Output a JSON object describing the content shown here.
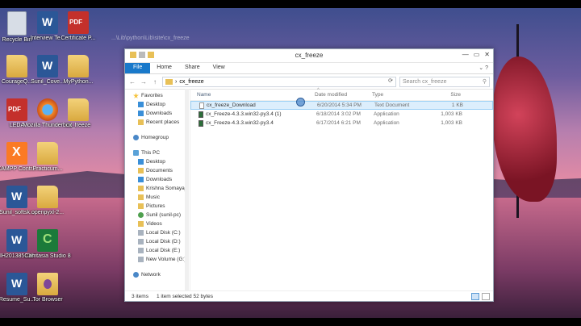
{
  "desktop": {
    "icons": [
      {
        "id": "recycle",
        "label": "Recycle Bin",
        "kind": "bin"
      },
      {
        "id": "interview",
        "label": "Interview Te...",
        "kind": "word"
      },
      {
        "id": "certificate",
        "label": "Certificate P...",
        "kind": "pdf"
      },
      {
        "id": "courage",
        "label": "CourageQ...",
        "kind": "folder"
      },
      {
        "id": "sunil-cover",
        "label": "Sunil_Cove...",
        "kind": "word"
      },
      {
        "id": "mypython",
        "label": "MyPython...",
        "kind": "folder"
      },
      {
        "id": "leda",
        "label": "LEDA",
        "kind": "pdf"
      },
      {
        "id": "firefox",
        "label": "Mozilla Thunderbird",
        "kind": "firefox"
      },
      {
        "id": "cxfreeze-desk",
        "label": "cx_freeze",
        "kind": "folder"
      },
      {
        "id": "xampp",
        "label": "XAMPP Contr...",
        "kind": "xampp"
      },
      {
        "id": "practicum",
        "label": "Practicum...",
        "kind": "folder"
      },
      {
        "id": "sunil-soft",
        "label": "Sunil_softsk...",
        "kind": "word"
      },
      {
        "id": "openpyxl",
        "label": "openpyxl-2...",
        "kind": "folder"
      },
      {
        "id": "ih",
        "label": "IH201385038",
        "kind": "word"
      },
      {
        "id": "camtasia",
        "label": "Camtasia Studio 8",
        "kind": "camtasia"
      },
      {
        "id": "resume",
        "label": "Resume_Su...",
        "kind": "word"
      },
      {
        "id": "tor",
        "label": "Tor Browser",
        "kind": "tor"
      }
    ]
  },
  "ghost_path": "...\\Lib\\python\\Lib\\site\\cx_freeze",
  "window": {
    "title": "cx_freeze",
    "controls": [
      "—",
      "▭",
      "✕"
    ],
    "ribbon": {
      "file": "File",
      "tabs": [
        "Home",
        "Share",
        "View"
      ],
      "expand": "⌄ ?"
    },
    "nav_buttons": [
      "←",
      "→",
      "↑"
    ],
    "address": "cx_freeze",
    "search_placeholder": "Search cx_freeze",
    "sidebar": {
      "favorites": "Favorites",
      "fav_items": [
        "Desktop",
        "Downloads",
        "Recent places"
      ],
      "homegroup": "Homegroup",
      "thispc": "This PC",
      "pc_items": [
        {
          "label": "Desktop",
          "icon": "blue"
        },
        {
          "label": "Documents",
          "icon": "yellow"
        },
        {
          "label": "Downloads",
          "icon": "blue"
        },
        {
          "label": "Krishna Somayaji",
          "icon": "yellow"
        },
        {
          "label": "Music",
          "icon": "yellow"
        },
        {
          "label": "Pictures",
          "icon": "yellow"
        },
        {
          "label": "Sunil (sunil-pc)",
          "icon": "green"
        },
        {
          "label": "Videos",
          "icon": "yellow"
        },
        {
          "label": "Local Disk (C:)",
          "icon": "disk"
        },
        {
          "label": "Local Disk (D:)",
          "icon": "disk"
        },
        {
          "label": "Local Disk (E:)",
          "icon": "disk"
        },
        {
          "label": "New Volume (G:)",
          "icon": "disk"
        }
      ],
      "network": "Network"
    },
    "columns": {
      "name": "Name",
      "date": "Date modified",
      "type": "Type",
      "size": "Size"
    },
    "files": [
      {
        "name": "cx_freeze_Download",
        "date": "6/20/2014 5:34 PM",
        "type": "Text Document",
        "size": "1 KB",
        "kind": "txt",
        "selected": true
      },
      {
        "name": "cx_Freeze-4.3.3.win32-py3.4 (1)",
        "date": "6/18/2014 3:02 PM",
        "type": "Application",
        "size": "1,003 KB",
        "kind": "app",
        "selected": false
      },
      {
        "name": "cx_Freeze-4.3.3.win32-py3.4",
        "date": "6/17/2014 6:21 PM",
        "type": "Application",
        "size": "1,003 KB",
        "kind": "app",
        "selected": false
      }
    ],
    "status": {
      "items": "3 items",
      "selected": "1 item selected  52 bytes"
    }
  }
}
